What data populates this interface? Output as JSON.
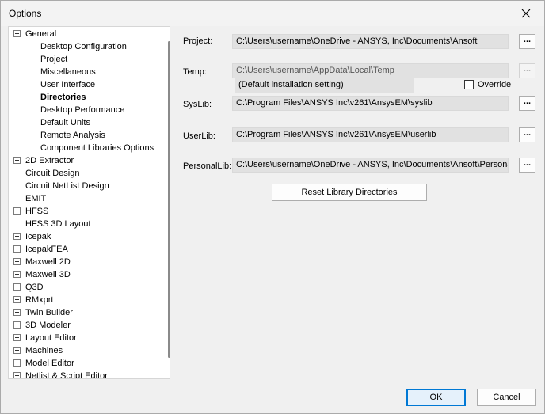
{
  "window": {
    "title": "Options"
  },
  "tree": {
    "items": [
      {
        "label": "General",
        "expander": "minus"
      },
      {
        "label": "Desktop Configuration",
        "expander": ""
      },
      {
        "label": "Project",
        "expander": ""
      },
      {
        "label": "Miscellaneous",
        "expander": ""
      },
      {
        "label": "User Interface",
        "expander": ""
      },
      {
        "label": "Directories",
        "expander": ""
      },
      {
        "label": "Desktop Performance",
        "expander": ""
      },
      {
        "label": "Default Units",
        "expander": ""
      },
      {
        "label": "Remote Analysis",
        "expander": ""
      },
      {
        "label": "Component Libraries Options",
        "expander": ""
      },
      {
        "label": "2D Extractor",
        "expander": "plus"
      },
      {
        "label": "Circuit Design",
        "expander": ""
      },
      {
        "label": "Circuit NetList Design",
        "expander": ""
      },
      {
        "label": "EMIT",
        "expander": ""
      },
      {
        "label": "HFSS",
        "expander": "plus"
      },
      {
        "label": "HFSS 3D Layout",
        "expander": ""
      },
      {
        "label": "Icepak",
        "expander": "plus"
      },
      {
        "label": "IcepakFEA",
        "expander": "plus"
      },
      {
        "label": "Maxwell 2D",
        "expander": "plus"
      },
      {
        "label": "Maxwell 3D",
        "expander": "plus"
      },
      {
        "label": "Q3D",
        "expander": "plus"
      },
      {
        "label": "RMxprt",
        "expander": "plus"
      },
      {
        "label": "Twin Builder",
        "expander": "plus"
      },
      {
        "label": "3D Modeler",
        "expander": "plus"
      },
      {
        "label": "Layout Editor",
        "expander": "plus"
      },
      {
        "label": "Machines",
        "expander": "plus"
      },
      {
        "label": "Model Editor",
        "expander": "plus"
      },
      {
        "label": "Netlist & Script Editor",
        "expander": "plus"
      }
    ],
    "selected": "Directories"
  },
  "directories": {
    "project": {
      "label": "Project:",
      "value": "C:\\Users\\username\\OneDrive - ANSYS, Inc\\Documents\\Ansoft",
      "browse": "..."
    },
    "temp": {
      "label": "Temp:",
      "value": "C:\\Users\\username\\AppData\\Local\\Temp",
      "browse": "...",
      "note": "(Default installation setting)",
      "override_label": "Override",
      "override_checked": false
    },
    "syslib": {
      "label": "SysLib:",
      "value": "C:\\Program Files\\ANSYS Inc\\v261\\AnsysEM\\syslib",
      "browse": "..."
    },
    "userlib": {
      "label": "UserLib:",
      "value": "C:\\Program Files\\ANSYS Inc\\v261\\AnsysEM\\userlib",
      "browse": "..."
    },
    "personallib": {
      "label": "PersonalLib:",
      "value": "C:\\Users\\username\\OneDrive - ANSYS, Inc\\Documents\\Ansoft\\PersonalLib",
      "browse": "..."
    },
    "reset_label": "Reset Library Directories"
  },
  "footer": {
    "ok_label": "OK",
    "cancel_label": "Cancel"
  }
}
